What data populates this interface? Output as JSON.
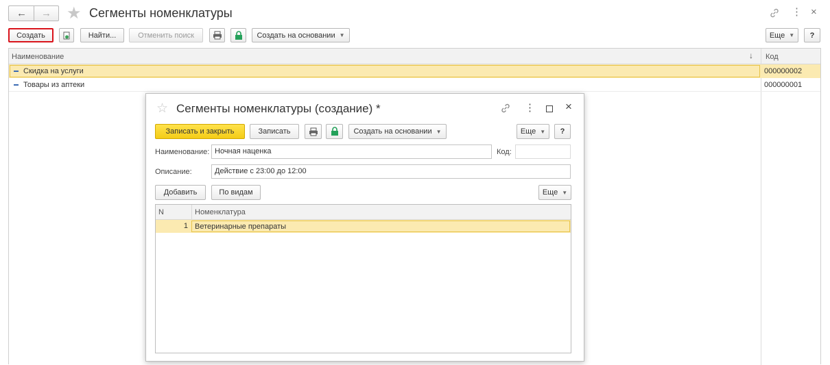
{
  "main": {
    "title": "Сегменты номенклатуры",
    "toolbar": {
      "create": "Создать",
      "find": "Найти...",
      "cancel_search": "Отменить поиск",
      "create_based": "Создать на основании",
      "more": "Еще",
      "help": "?"
    },
    "columns": {
      "name": "Наименование",
      "code": "Код"
    },
    "rows": [
      {
        "name": "Скидка на услуги",
        "code": "000000002"
      },
      {
        "name": "Товары из аптеки",
        "code": "000000001"
      }
    ]
  },
  "dialog": {
    "title": "Сегменты номенклатуры (создание) *",
    "toolbar": {
      "save_close": "Записать и закрыть",
      "save": "Записать",
      "create_based": "Создать на основании",
      "more": "Еще",
      "help": "?"
    },
    "fields": {
      "name_label": "Наименование:",
      "name_value": "Ночная наценка",
      "code_label": "Код:",
      "code_value": "",
      "desc_label": "Описание:",
      "desc_value": "Действие с 23:00 до 12:00"
    },
    "table_toolbar": {
      "add": "Добавить",
      "by_types": "По видам",
      "more": "Еще"
    },
    "table": {
      "columns": {
        "n": "N",
        "item": "Номенклатура"
      },
      "rows": [
        {
          "n": "1",
          "item": "Ветеринарные препараты"
        }
      ]
    }
  },
  "colors": {
    "accent_yellow": "#f4cc16",
    "highlight_row": "#fbeab1",
    "red_outline": "#d9131b",
    "lock_green": "#24a15a"
  }
}
